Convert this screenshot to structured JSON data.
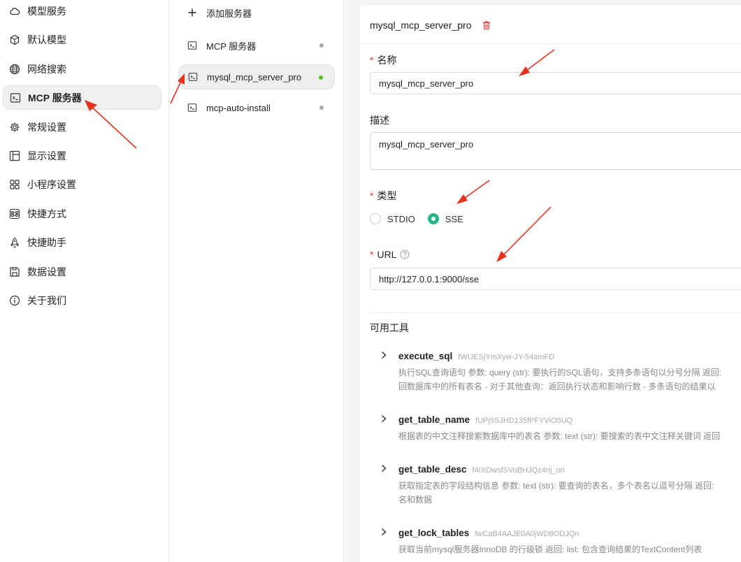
{
  "sidebar": {
    "items": [
      {
        "label": "模型服务",
        "icon": "cloud-icon"
      },
      {
        "label": "默认模型",
        "icon": "cube-icon"
      },
      {
        "label": "网络搜索",
        "icon": "globe-icon"
      },
      {
        "label": "MCP 服务器",
        "icon": "terminal-icon",
        "active": true
      },
      {
        "label": "常规设置",
        "icon": "gear-icon"
      },
      {
        "label": "显示设置",
        "icon": "layout-icon"
      },
      {
        "label": "小程序设置",
        "icon": "grid-icon"
      },
      {
        "label": "快捷方式",
        "icon": "command-icon"
      },
      {
        "label": "快捷助手",
        "icon": "rocket-icon"
      },
      {
        "label": "数据设置",
        "icon": "save-icon"
      },
      {
        "label": "关于我们",
        "icon": "info-icon"
      }
    ]
  },
  "servers": {
    "add_label": "添加服务器",
    "items": [
      {
        "label": "MCP 服务器",
        "status": "inactive"
      },
      {
        "label": "mysql_mcp_server_pro",
        "status": "active"
      },
      {
        "label": "mcp-auto-install",
        "status": "inactive"
      }
    ]
  },
  "detail": {
    "title": "mysql_mcp_server_pro",
    "name_label": "名称",
    "name_value": "mysql_mcp_server_pro",
    "desc_label": "描述",
    "desc_value": "mysql_mcp_server_pro",
    "type_label": "类型",
    "type_options": [
      "STDIO",
      "SSE"
    ],
    "type_selected": "SSE",
    "url_label": "URL",
    "url_value": "http://127.0.0.1:9000/sse",
    "tools_label": "可用工具",
    "tools": [
      {
        "name": "execute_sql",
        "id": "fWIJESjYmXyw-JY-54amFD",
        "desc": [
          "执行SQL查询语句 参数: query (str): 要执行的SQL语句，支持多条语句以分号分隔 返回:",
          "回数据库中的所有表名 - 对于其他查询：返回执行状态和影响行数 - 多条语句的结果以"
        ]
      },
      {
        "name": "get_table_name",
        "id": "fUPj5SJHD135fPFYViO5UQ",
        "desc": [
          "根据表的中文注释搜索数据库中的表名 参数: text (str): 要搜索的表中文注释关键词 返回"
        ]
      },
      {
        "name": "get_table_desc",
        "id": "f4IXDwsfSVoBHJQz4nj_on",
        "desc": [
          "获取指定表的字段结构信息 参数: text (str): 要查询的表名，多个表名以逗号分隔 返回:",
          "名和数据"
        ]
      },
      {
        "name": "get_lock_tables",
        "id": "fwCaB4AAJE0A0jWD8ODJQn",
        "desc": [
          "获取当前mysql服务器InnoDB 的行级锁 返回: list: 包含查询结果的TextContent列表"
        ]
      }
    ]
  },
  "colors": {
    "accent": "#1eb980",
    "required": "#e53935",
    "arrow": "#e8301c",
    "status_on": "#52c41a",
    "status_off": "#a8a8a8"
  }
}
